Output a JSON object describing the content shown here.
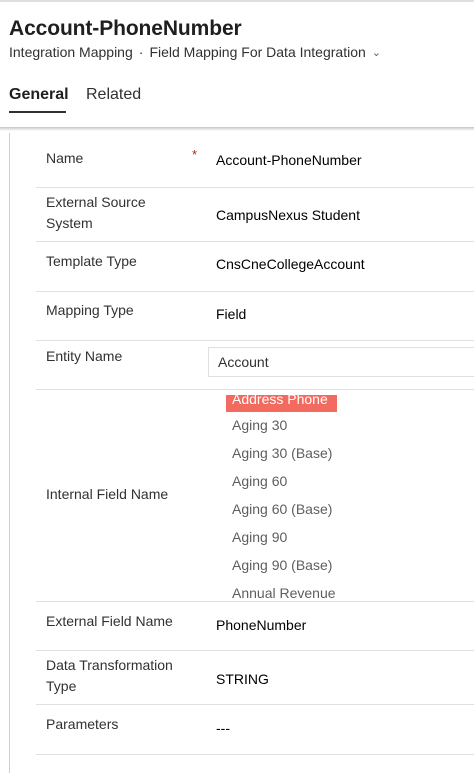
{
  "record": {
    "title": "Account-PhoneNumber",
    "breadcrumb": {
      "entity": "Integration Mapping",
      "separator": "·",
      "form": "Field Mapping For Data Integration"
    },
    "tabs": [
      {
        "label": "General",
        "selected": true
      },
      {
        "label": "Related",
        "selected": false
      }
    ]
  },
  "fields": {
    "name": {
      "label": "Name",
      "required_marker": "*",
      "value": "Account-PhoneNumber"
    },
    "external_source_system": {
      "label_line1": "External Source",
      "label_line2": "System",
      "value": "CampusNexus Student"
    },
    "template_type": {
      "label": "Template Type",
      "value": "CnsCneCollegeAccount"
    },
    "mapping_type": {
      "label": "Mapping Type",
      "value": "Field"
    },
    "entity_name": {
      "label": "Entity Name",
      "value": "Account"
    },
    "internal_field_name": {
      "label": "Internal Field Name",
      "selected": "Address Phone",
      "options": [
        "Aging 30",
        "Aging 30 (Base)",
        "Aging 60",
        "Aging 60 (Base)",
        "Aging 90",
        "Aging 90 (Base)",
        "Annual Revenue"
      ]
    },
    "external_field_name": {
      "label": "External Field Name",
      "value": "PhoneNumber"
    },
    "data_transformation_type": {
      "label_line1": "Data Transformation",
      "label_line2": "Type",
      "value": "STRING"
    },
    "parameters": {
      "label": "Parameters",
      "value": "---"
    }
  },
  "colors": {
    "selected_option_bg": "#f36a5e",
    "required_marker": "#a4262c",
    "divider": "#e1dfdd"
  }
}
